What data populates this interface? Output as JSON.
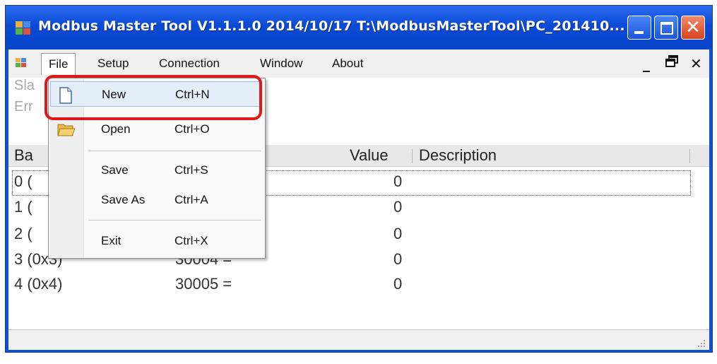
{
  "window": {
    "title": "Modbus Master Tool V1.1.1.0  2014/10/17   T:\\ModbusMasterTool\\PC_201410...",
    "minimize_glyph": "_",
    "close_glyph": "✕"
  },
  "menubar": {
    "items": [
      "File",
      "Setup",
      "Connection",
      "Window",
      "About"
    ],
    "mdi_minimize": "_",
    "mdi_restore": "🗗",
    "mdi_close": "✕"
  },
  "status": {
    "line1": "Sla",
    "line2": "Err"
  },
  "table": {
    "headers": {
      "base": "Ba",
      "value": "Value",
      "description": "Description"
    },
    "rows": [
      {
        "base": "0 (",
        "addr": "",
        "value": "0"
      },
      {
        "base": "1 (",
        "addr": "",
        "value": "0"
      },
      {
        "base": "2 (",
        "addr": "",
        "value": "0"
      },
      {
        "base": "3 (0x3)",
        "addr": "30004  =",
        "value": "0"
      },
      {
        "base": "4 (0x4)",
        "addr": "30005  =",
        "value": "0"
      }
    ]
  },
  "file_menu": {
    "items": [
      {
        "label": "New",
        "shortcut": "Ctrl+N",
        "icon": "new-file-icon"
      },
      {
        "label": "Open",
        "shortcut": "Ctrl+O",
        "icon": "open-folder-icon"
      },
      {
        "label": "Save",
        "shortcut": "Ctrl+S"
      },
      {
        "label": "Save As",
        "shortcut": "Ctrl+A"
      },
      {
        "label": "Exit",
        "shortcut": "Ctrl+X"
      }
    ]
  },
  "colors": {
    "titlebar": "#0a4ad6",
    "highlight": "#e01818"
  }
}
